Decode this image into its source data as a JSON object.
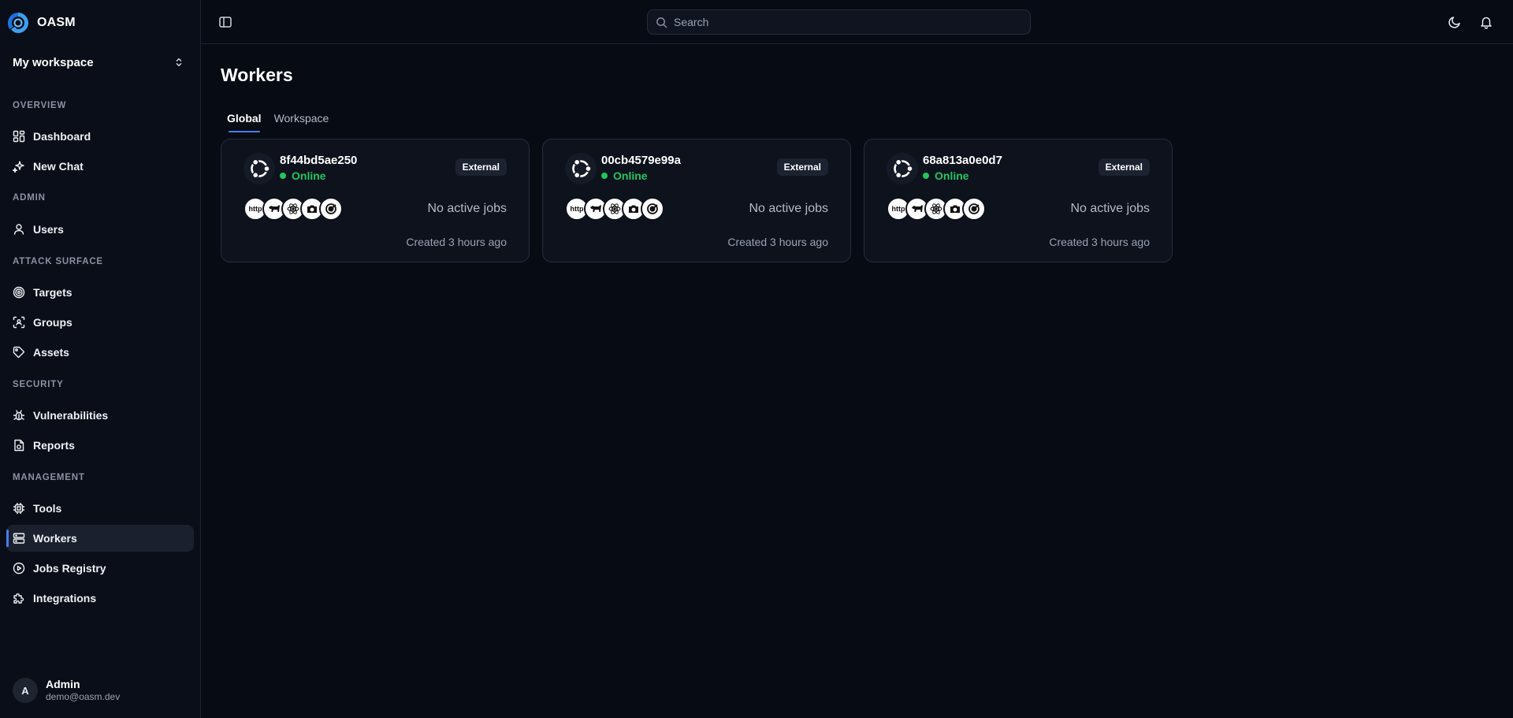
{
  "app": {
    "name": "OASM"
  },
  "workspace": {
    "name": "My workspace"
  },
  "sidebar": {
    "sections": [
      {
        "label": "OVERVIEW"
      },
      {
        "label": "ADMIN"
      },
      {
        "label": "ATTACK SURFACE"
      },
      {
        "label": "SECURITY"
      },
      {
        "label": "MANAGEMENT"
      }
    ],
    "items": [
      {
        "label": "Dashboard",
        "icon": "dashboard-grid-icon"
      },
      {
        "label": "New Chat",
        "icon": "sparkles-icon"
      },
      {
        "label": "Users",
        "icon": "user-icon"
      },
      {
        "label": "Targets",
        "icon": "target-icon"
      },
      {
        "label": "Groups",
        "icon": "group-scan-icon"
      },
      {
        "label": "Assets",
        "icon": "tag-icon"
      },
      {
        "label": "Vulnerabilities",
        "icon": "bug-icon"
      },
      {
        "label": "Reports",
        "icon": "report-icon"
      },
      {
        "label": "Tools",
        "icon": "chip-icon"
      },
      {
        "label": "Workers",
        "icon": "server-icon",
        "active": true
      },
      {
        "label": "Jobs Registry",
        "icon": "play-circle-icon"
      },
      {
        "label": "Integrations",
        "icon": "puzzle-icon"
      }
    ]
  },
  "user": {
    "initial": "A",
    "name": "Admin",
    "email": "demo@oasm.dev"
  },
  "header": {
    "search_placeholder": "Search"
  },
  "page": {
    "title": "Workers",
    "tabs": [
      {
        "label": "Global",
        "active": true
      },
      {
        "label": "Workspace",
        "active": false
      }
    ]
  },
  "workers": [
    {
      "id": "8f44bd5ae250",
      "status": "Online",
      "type": "External",
      "jobs": "No active jobs",
      "created": "Created 3 hours ago",
      "tool_http": "http"
    },
    {
      "id": "00cb4579e99a",
      "status": "Online",
      "type": "External",
      "jobs": "No active jobs",
      "created": "Created 3 hours ago",
      "tool_http": "http"
    },
    {
      "id": "68a813a0e0d7",
      "status": "Online",
      "type": "External",
      "jobs": "No active jobs",
      "created": "Created 3 hours ago",
      "tool_http": "http"
    }
  ],
  "colors": {
    "accent": "#4a7cf4",
    "online": "#22c55e",
    "background": "#070b14"
  }
}
